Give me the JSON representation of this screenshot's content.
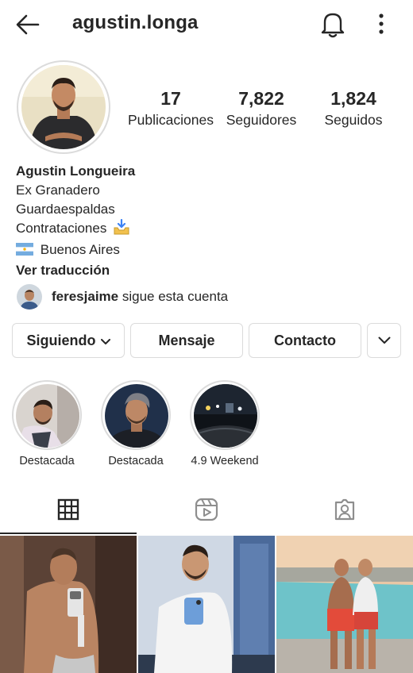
{
  "header": {
    "username": "agustin.longa",
    "back_icon": "arrow-left-icon",
    "notifications_icon": "bell-icon",
    "more_icon": "vertical-dots-icon"
  },
  "stats": {
    "posts": {
      "value": "17",
      "label": "Publicaciones"
    },
    "followers": {
      "value": "7,822",
      "label": "Seguidores"
    },
    "following": {
      "value": "1,824",
      "label": "Seguidos"
    }
  },
  "bio": {
    "name": "Agustin Longueira",
    "lines": [
      "Ex Granadero",
      "Guardaespaldas",
      "Contrataciones",
      "Buenos Aires"
    ],
    "translate_link": "Ver traducción"
  },
  "followed_by": {
    "username": "feresjaime",
    "text": "sigue esta cuenta"
  },
  "actions": {
    "following_label": "Siguiendo",
    "message_label": "Mensaje",
    "contact_label": "Contacto"
  },
  "highlights": [
    {
      "label": "Destacada"
    },
    {
      "label": "Destacada"
    },
    {
      "label": "4.9 Weekend"
    }
  ],
  "tabs": [
    {
      "name": "grid",
      "icon": "grid-icon",
      "active": true
    },
    {
      "name": "reels",
      "icon": "reels-icon",
      "active": false
    },
    {
      "name": "tagged",
      "icon": "tagged-person-icon",
      "active": false
    }
  ],
  "colors": {
    "text": "#262626",
    "border": "#dbdbdb",
    "background": "#ffffff"
  }
}
